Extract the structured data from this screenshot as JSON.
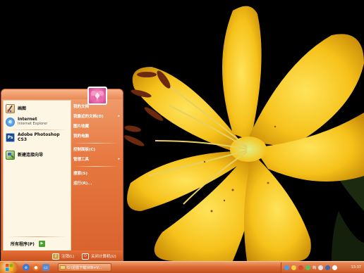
{
  "start_menu": {
    "left_programs": [
      {
        "title": "画图",
        "subtitle": "",
        "icon": "paint-icon",
        "icon_color": "#c8a060"
      },
      {
        "title": "Internet",
        "subtitle": "Internet Explorer",
        "icon": "internet-explorer-icon",
        "icon_color": "#2a7fd6"
      },
      {
        "title": "Adobe Photoshop CS3",
        "subtitle": "",
        "icon": "photoshop-icon",
        "icon_color": "#1b4b8c"
      },
      {
        "title": "新建连接向导",
        "subtitle": "",
        "icon": "connection-wizard-icon",
        "icon_color": "#3c8a3c"
      }
    ],
    "photoshop_icon_text": "Ps",
    "all_programs_label": "所有程序(P)",
    "right_items": [
      {
        "label": "我的文档",
        "has_arrow": false
      },
      {
        "label": "我最近的文档(D)",
        "has_arrow": true
      },
      {
        "label": "图片收藏",
        "has_arrow": false
      },
      {
        "label": "我的电脑",
        "has_arrow": false
      },
      {
        "label": "控制面板(C)",
        "has_arrow": false
      },
      {
        "label": "管理工具",
        "has_arrow": true
      },
      {
        "label": "搜索(S)",
        "has_arrow": false
      },
      {
        "label": "运行(R)...",
        "has_arrow": false
      }
    ],
    "logoff_label": "注销(L)",
    "shutdown_label": "关闭计算机(U)"
  },
  "taskbar": {
    "task_button_label": "G:\\迅雷下载\\WB+V...",
    "tray_text": "韩",
    "clock": "13:37"
  },
  "colors": {
    "accent": "#e2703a",
    "taskbar_dark": "#c2501e",
    "left_pane_bg": "#fdf6e4",
    "lily_yellow": "#f6c21a"
  }
}
